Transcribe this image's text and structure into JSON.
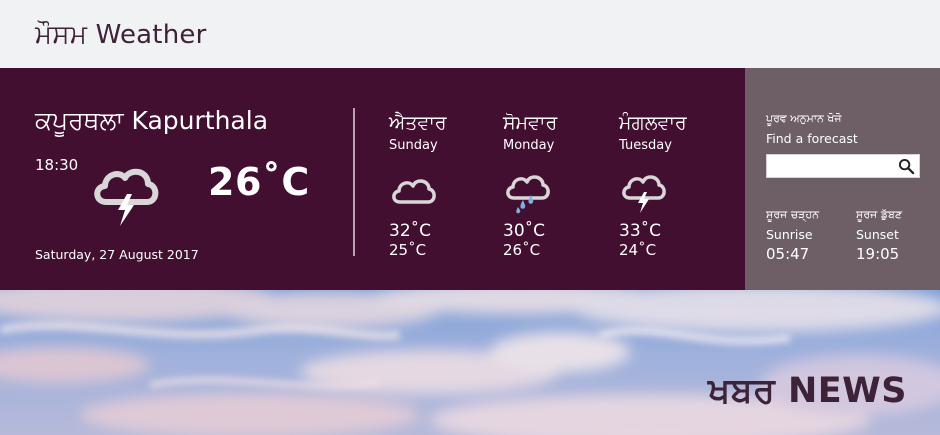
{
  "app": {
    "title": "ਮੌਸਮ Weather"
  },
  "current": {
    "city": "ਕਪੂਰਥਲਾ  Kapurthala",
    "time": "18:30",
    "temp": "26˚C",
    "date": "Saturday, 27 August 2017",
    "icon": "thunderstorm-icon"
  },
  "forecast": [
    {
      "day_pa": "ਐਤਵਾਰ",
      "day_en": "Sunday",
      "icon": "cloud-icon",
      "high": "32˚C",
      "low": "25˚C"
    },
    {
      "day_pa": "ਸੋਮਵਾਰ",
      "day_en": "Monday",
      "icon": "rain-cloud-icon",
      "high": "30˚C",
      "low": "26˚C"
    },
    {
      "day_pa": "ਮੰਗਲਵਾਰ",
      "day_en": "Tuesday",
      "icon": "thunderstorm-icon",
      "high": "33˚C",
      "low": "24˚C"
    }
  ],
  "search": {
    "label_pa": "ਪੂਰਵ ਅਨੁਮਾਨ ਖੋਜੋ",
    "label_en": "Find a forecast",
    "value": "",
    "icon": "search-icon"
  },
  "sun": {
    "sunrise_pa": "ਸੂਰਜ ਚੜ੍ਹਨ",
    "sunrise_en": "Sunrise",
    "sunrise_time": "05:47",
    "sunset_pa": "ਸੂਰਜ ਡੁੱਬਣ",
    "sunset_en": "Sunset",
    "sunset_time": "19:05"
  },
  "news": {
    "title": "ਖਬਰ NEWS"
  },
  "colors": {
    "topbar": "#f1f2f4",
    "weather_panel": "#430f30",
    "side_panel": "#6e5f67",
    "title_text": "#3e2237",
    "icon_grey": "#d9d6d8",
    "rain_drop": "#7fb0e0"
  }
}
